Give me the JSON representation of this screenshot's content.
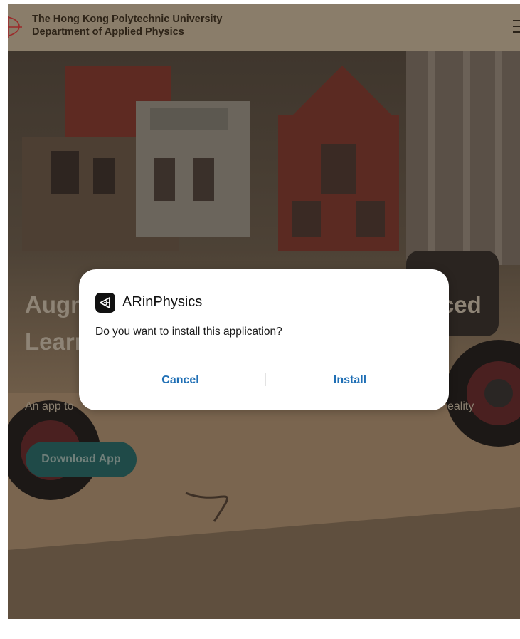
{
  "header": {
    "university": "The Hong Kong Polytechnic University",
    "department": "Department of Applied Physics",
    "menu_icon": "hamburger-menu-icon"
  },
  "hero": {
    "title": "Augmented Reality Models for Enhanced Learning",
    "subtitle_start": "An app to",
    "subtitle_end": "eality",
    "download_label": "Download App"
  },
  "dialog": {
    "app_name": "ARinPhysics",
    "app_icon": "unity-logo-icon",
    "question": "Do you want to install this application?",
    "cancel_label": "Cancel",
    "install_label": "Install"
  },
  "colors": {
    "accent": "#1f6fb5",
    "overlay": "#6b5a46",
    "download_button": "#1f4a48"
  }
}
